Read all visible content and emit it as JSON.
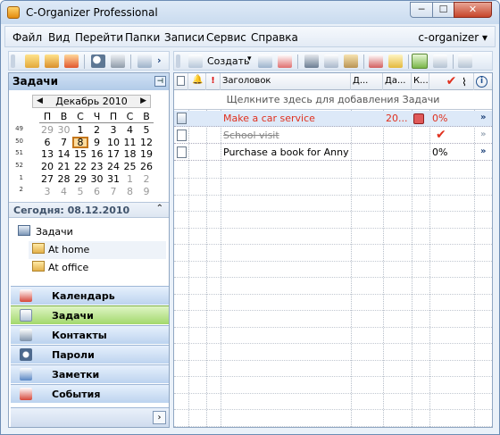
{
  "window": {
    "title": "C-Organizer Professional",
    "min_label": "─",
    "max_label": "☐",
    "close_label": "✕"
  },
  "menu": {
    "items": [
      "Файл",
      "Вид",
      "Перейти",
      "Папки",
      "Записи",
      "Сервис",
      "Справка"
    ],
    "profile": "c-organizer ▾"
  },
  "toolbar": {
    "create_label": "Создать"
  },
  "left_pane": {
    "title": "Задачи",
    "calendar": {
      "month_label": "Декабрь 2010",
      "weekdays": [
        "П",
        "В",
        "С",
        "Ч",
        "П",
        "С",
        "В"
      ],
      "week_numbers": [
        "49",
        "50",
        "51",
        "52",
        "1",
        "2"
      ],
      "weeks": [
        [
          "29",
          "30",
          "1",
          "2",
          "3",
          "4",
          "5"
        ],
        [
          "6",
          "7",
          "8",
          "9",
          "10",
          "11",
          "12"
        ],
        [
          "13",
          "14",
          "15",
          "16",
          "17",
          "18",
          "19"
        ],
        [
          "20",
          "21",
          "22",
          "23",
          "24",
          "25",
          "26"
        ],
        [
          "27",
          "28",
          "29",
          "30",
          "31",
          "1",
          "2"
        ],
        [
          "3",
          "4",
          "5",
          "6",
          "7",
          "8",
          "9"
        ]
      ],
      "selected_day": "8"
    },
    "today_label": "Сегодня: 08.12.2010",
    "tree": {
      "root": "Задачи",
      "children": [
        "At home",
        "At office"
      ]
    },
    "nav": [
      "Календарь",
      "Задачи",
      "Контакты",
      "Пароли",
      "Заметки",
      "События"
    ],
    "nav_selected": "Задачи"
  },
  "grid": {
    "columns": [
      "",
      "",
      "!",
      "Заголовок",
      "Д...",
      "Да...",
      "К...",
      "✔",
      "",
      ""
    ],
    "add_hint": "Щелкните здесь для добавления Задачи",
    "rows": [
      {
        "title": "Make a car service",
        "date": "20...",
        "progress": "0%",
        "style": "overdue"
      },
      {
        "title": "School visit",
        "date": "",
        "progress": "",
        "style": "done"
      },
      {
        "title": "Purchase a book for Anny",
        "date": "",
        "progress": "0%",
        "style": "normal"
      }
    ]
  },
  "colors": {
    "overdue": "#e0301e",
    "done": "#888888",
    "selected_nav": "#a2d86c"
  }
}
